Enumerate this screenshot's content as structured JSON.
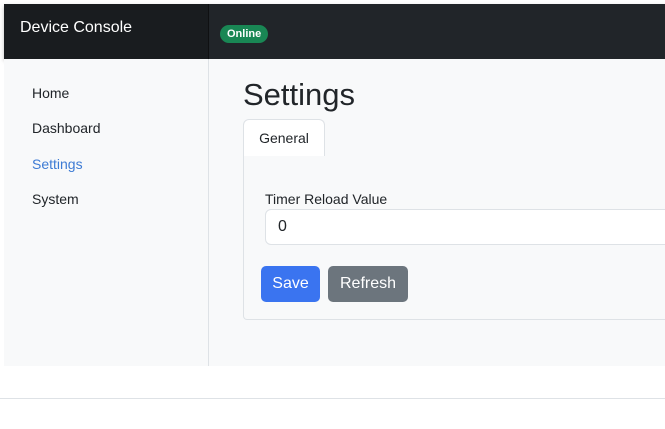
{
  "app": {
    "title": "Device Console",
    "status": "Online",
    "status_color": "#198754"
  },
  "sidebar": {
    "items": [
      {
        "label": "Home"
      },
      {
        "label": "Dashboard"
      },
      {
        "label": "Settings",
        "active": true
      },
      {
        "label": "System"
      }
    ]
  },
  "main": {
    "title": "Settings",
    "tabs": [
      {
        "label": "General",
        "active": true
      }
    ],
    "form": {
      "timer_label": "Timer Reload Value",
      "timer_value": "0"
    },
    "buttons": {
      "save": "Save",
      "refresh": "Refresh"
    }
  },
  "colors": {
    "accent": "#3a74f0",
    "secondary": "#6c757d",
    "topbar": "#212529",
    "active_link": "#3d7bd4"
  }
}
